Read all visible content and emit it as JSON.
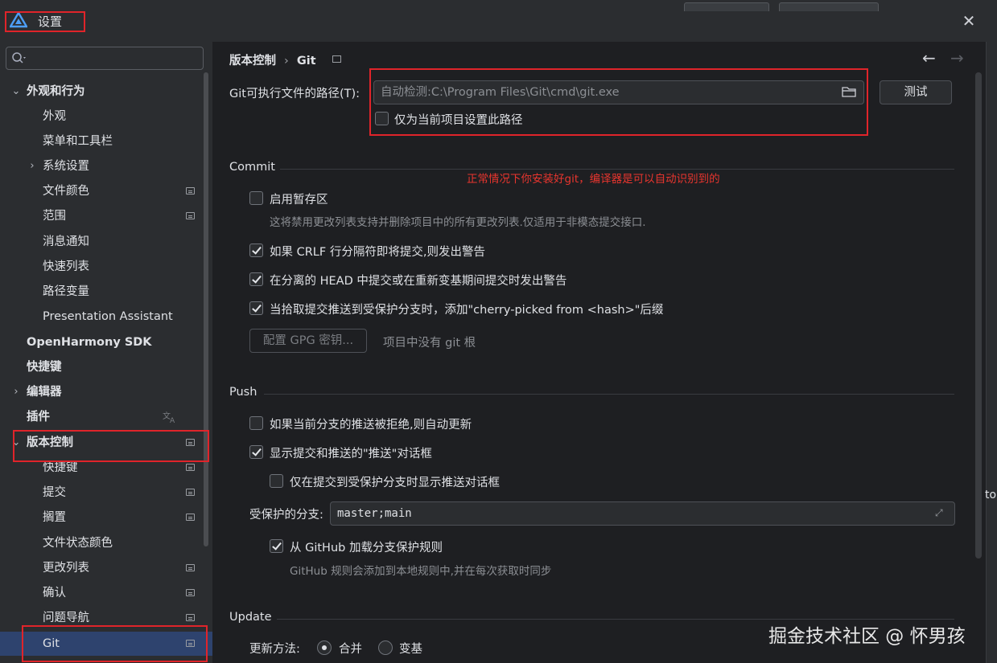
{
  "window": {
    "title": "设置",
    "close_icon": "close-icon"
  },
  "sidebar": {
    "search_placeholder": "",
    "items": [
      {
        "label": "外观和行为",
        "arrow": "⌄"
      },
      {
        "label": "外观"
      },
      {
        "label": "菜单和工具栏"
      },
      {
        "label": "系统设置",
        "arrow": "›"
      },
      {
        "label": "文件颜色"
      },
      {
        "label": "范围"
      },
      {
        "label": "消息通知"
      },
      {
        "label": "快速列表"
      },
      {
        "label": "路径变量"
      },
      {
        "label": "Presentation Assistant"
      },
      {
        "label": "OpenHarmony SDK"
      },
      {
        "label": "快捷键"
      },
      {
        "label": "编辑器",
        "arrow": "›"
      },
      {
        "label": "插件"
      },
      {
        "label": "版本控制",
        "arrow": "⌄"
      },
      {
        "label": "快捷键"
      },
      {
        "label": "提交"
      },
      {
        "label": "搁置"
      },
      {
        "label": "文件状态颜色"
      },
      {
        "label": "更改列表"
      },
      {
        "label": "确认"
      },
      {
        "label": "问题导航"
      },
      {
        "label": "Git"
      }
    ]
  },
  "breadcrumb": {
    "parent": "版本控制",
    "separator": "›",
    "current": "Git"
  },
  "nav": {
    "back": "←",
    "forward": "→"
  },
  "git_path": {
    "label": "Git可执行文件的路径(T):",
    "value": "自动检测:C:\\Program Files\\Git\\cmd\\git.exe",
    "test_button": "测试",
    "project_only_label": "仅为当前项目设置此路径",
    "project_only_checked": false
  },
  "annotation": {
    "note": "正常情况下你安装好git，编译器是可以自动识别到的"
  },
  "commit": {
    "title": "Commit",
    "staging_label": "启用暂存区",
    "staging_checked": false,
    "staging_hint": "这将禁用更改列表支持并删除项目中的所有更改列表.仅适用于非模态提交接口.",
    "crlf_label": "如果 CRLF 行分隔符即将提交,则发出警告",
    "crlf_checked": true,
    "detached_label": "在分离的 HEAD 中提交或在重新变基期间提交时发出警告",
    "detached_checked": true,
    "cherry_label": "当拾取提交推送到受保护分支时，添加\"cherry-picked from <hash>\"后缀",
    "cherry_checked": true,
    "gpg_button": "配置 GPG 密钥...",
    "no_git_root": "项目中没有 git 根"
  },
  "push": {
    "title": "Push",
    "auto_update_label": "如果当前分支的推送被拒绝,则自动更新",
    "auto_update_checked": false,
    "show_dialog_label": "显示提交和推送的\"推送\"对话框",
    "show_dialog_checked": true,
    "protected_only_label": "仅在提交到受保护分支时显示推送对话框",
    "protected_only_checked": false,
    "protected_branches_label": "受保护的分支:",
    "protected_branches_value": "master;main",
    "github_rules_label": "从 GitHub 加载分支保护规则",
    "github_rules_checked": true,
    "github_rules_hint": "GitHub 规则会添加到本地规则中,并在每次获取时同步"
  },
  "update": {
    "title": "Update",
    "method_label": "更新方法:",
    "options": [
      "合并",
      "变基"
    ],
    "selected": "合并"
  },
  "watermark": "掘金技术社区 @ 怀男孩",
  "right_edge_text": "to",
  "colors": {
    "annotation_red": "#e0242a",
    "selection_blue": "#2e436e",
    "background": "#1e1f22"
  }
}
